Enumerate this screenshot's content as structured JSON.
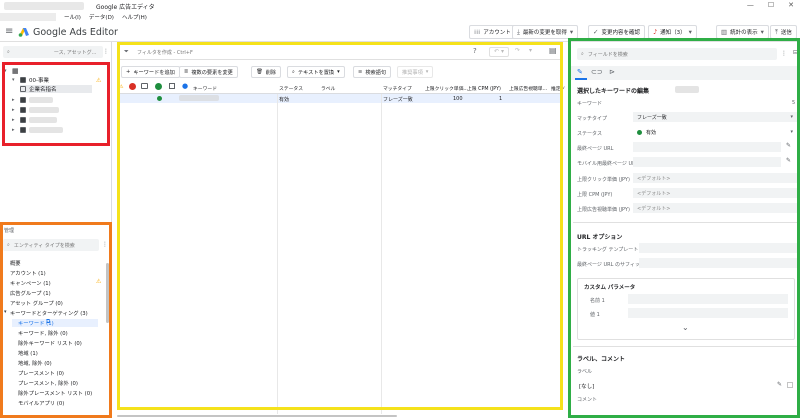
{
  "window": {
    "title": "Google 広告エディタ",
    "controls": [
      "—",
      "☐",
      "✕"
    ]
  },
  "menu": {
    "items": [
      "ール(I)",
      "データ(D)",
      "ヘルプ(H)"
    ]
  },
  "app": {
    "name": "Google Ads Editor",
    "toolbar": {
      "account": "アカウント",
      "get_changes": "最新の変更を取得",
      "check_changes": "変更内容を確認",
      "notifications": "通知（3）",
      "stats": "統計の表示",
      "post": "送信"
    }
  },
  "tree": {
    "search_placeholder": "ース, アセットグ...",
    "rows": [
      {
        "label": ""
      },
      {
        "label": "00-事業"
      },
      {
        "label": "企業名指名"
      }
    ]
  },
  "management": {
    "title": "管理",
    "search_placeholder": "エンティティ タイプを検索",
    "items": [
      "概要",
      "アカウント (1)",
      "キャンペーン (1)",
      "広告グループ (1)",
      "アセット グループ (0)",
      "キーワードとターゲティング (3)",
      "キーワード (1)",
      "キーワード, 除外 (0)",
      "除外キーワード リスト (0)",
      "地域 (1)",
      "地域, 除外 (0)",
      "プレースメント (0)",
      "プレースメント, 除外 (0)",
      "除外プレースメント リスト (0)",
      "モバイルアプリ (0)"
    ]
  },
  "grid": {
    "filter_placeholder": "フィルタを作成 - Ctrl+F",
    "actions": {
      "add_keyword": "キーワードを追加",
      "edit_multiple": "複数の要素を変更",
      "delete": "削除",
      "replace_text": "テキストを置換",
      "find_keywords": "検索語句",
      "recommendations": "推奨事項"
    },
    "columns": {
      "keyword": "キーワード",
      "status": "ステータス",
      "label": "ラベル",
      "match_type": "マッチタイプ",
      "max_cpc": "上限クリック単価...",
      "max_cpm": "上限 CPM (JPY)",
      "max_cpv": "上限広告視聴単...",
      "recommended": "推定ノ"
    },
    "row": {
      "status": "有効",
      "match_type": "フレーズ一致",
      "max_cpc": "100",
      "max_cpm": "1"
    }
  },
  "editor": {
    "search_placeholder": "フィールドを検索",
    "heading": "選択したキーワードの編集",
    "fields": {
      "keyword_label": "キーワード",
      "keyword_count": "5",
      "match_type_label": "マッチタイプ",
      "match_type_value": "フレーズ一致",
      "status_label": "ステータス",
      "status_value": "有効",
      "final_url_label": "最終ページ URL",
      "mobile_url_label": "モバイル用最終ページ URL",
      "max_cpc_label": "上限クリック単価 (JPY)",
      "max_cpc_value": "<デフォルト>",
      "max_cpm_label": "上限 CPM (JPY)",
      "max_cpm_value": "<デフォルト>",
      "max_cpv_label": "上限広告視聴単価 (JPY)",
      "max_cpv_value": "<デフォルト>"
    },
    "url_options": {
      "title": "URL オプション",
      "tracking_label": "トラッキング テンプレート",
      "suffix_label": "最終ページ URL のサフィックス",
      "custom_title": "カスタム パラメータ",
      "name_label": "名前 1",
      "value_label": "値 1"
    },
    "labels_comments": {
      "title": "ラベル、コメント",
      "label_label": "ラベル",
      "label_value": "[なし]",
      "comment_label": "コメント"
    }
  },
  "colors": {
    "red_frame": "#e8202a",
    "orange_frame": "#f07a1c",
    "yellow_frame": "#f5e21b",
    "green_frame": "#2fae46",
    "accent": "#1a73e8",
    "status_green": "#1e8e3e"
  }
}
